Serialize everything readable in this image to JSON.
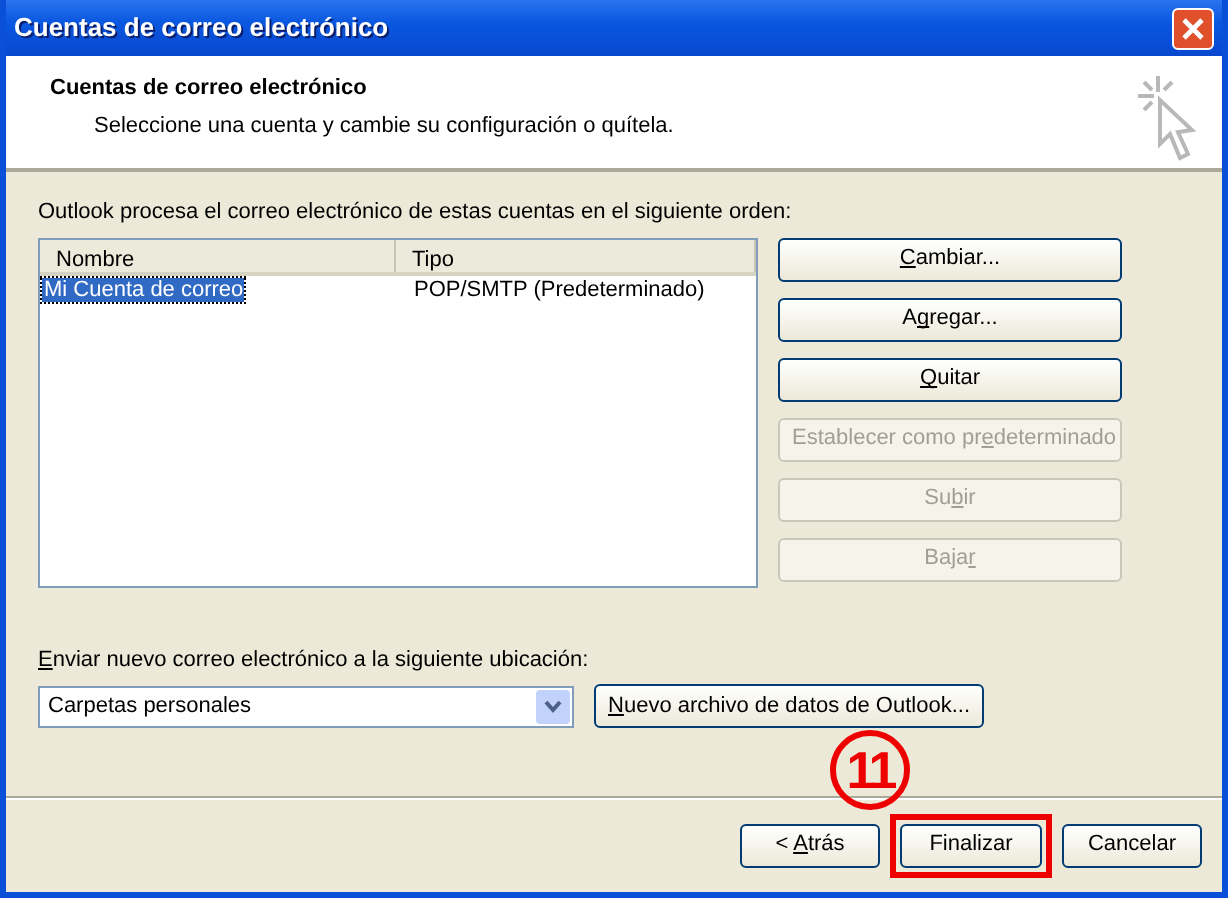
{
  "window": {
    "title": "Cuentas de correo electrónico"
  },
  "header": {
    "title": "Cuentas de correo electrónico",
    "subtitle": "Seleccione una cuenta y cambie su configuración o quítela."
  },
  "accounts_label": "Outlook procesa el correo electrónico de estas cuentas en el siguiente orden:",
  "table": {
    "columns": [
      "Nombre",
      "Tipo"
    ],
    "rows": [
      {
        "cells": [
          "Mi Cuenta de correo",
          "POP/SMTP (Predeterminado)"
        ],
        "selected": true
      }
    ]
  },
  "side_buttons": [
    {
      "label": [
        {
          "text": "C",
          "underlined": true
        },
        {
          "text": "ambiar...",
          "underlined": false
        }
      ],
      "disabled": false
    },
    {
      "label": [
        {
          "text": "A",
          "underlined": false
        },
        {
          "text": "g",
          "underlined": true
        },
        {
          "text": "regar...",
          "underlined": false
        }
      ],
      "disabled": false
    },
    {
      "label": [
        {
          "text": "Q",
          "underlined": true
        },
        {
          "text": "uitar",
          "underlined": false
        }
      ],
      "disabled": false
    },
    {
      "label": [
        {
          "text": "Establecer como pr",
          "underlined": false
        },
        {
          "text": "e",
          "underlined": true
        },
        {
          "text": "determinado",
          "underlined": false
        }
      ],
      "disabled": true
    },
    {
      "label": [
        {
          "text": "Su",
          "underlined": false
        },
        {
          "text": "b",
          "underlined": true
        },
        {
          "text": "ir",
          "underlined": false
        }
      ],
      "disabled": true
    },
    {
      "label": [
        {
          "text": "Baja",
          "underlined": false
        },
        {
          "text": "r",
          "underlined": true
        }
      ],
      "disabled": true
    }
  ],
  "location": {
    "label": [
      {
        "text": "E",
        "underlined": true
      },
      {
        "text": "nviar nuevo correo electrónico a la siguiente ubicación:",
        "underlined": false
      }
    ],
    "value": "Carpetas personales",
    "button": {
      "label": [
        {
          "text": "N",
          "underlined": true
        },
        {
          "text": "uevo archivo de datos de Outlook...",
          "underlined": false
        }
      ]
    }
  },
  "step_marker": "11",
  "footer_buttons": [
    {
      "label": [
        {
          "text": "< ",
          "underlined": false
        },
        {
          "text": "A",
          "underlined": true
        },
        {
          "text": "trás",
          "underlined": false
        }
      ],
      "highlighted": false
    },
    {
      "label": [
        {
          "text": "Finalizar",
          "underlined": false
        }
      ],
      "highlighted": true
    },
    {
      "label": [
        {
          "text": "Cancelar",
          "underlined": false
        }
      ],
      "highlighted": false
    }
  ]
}
